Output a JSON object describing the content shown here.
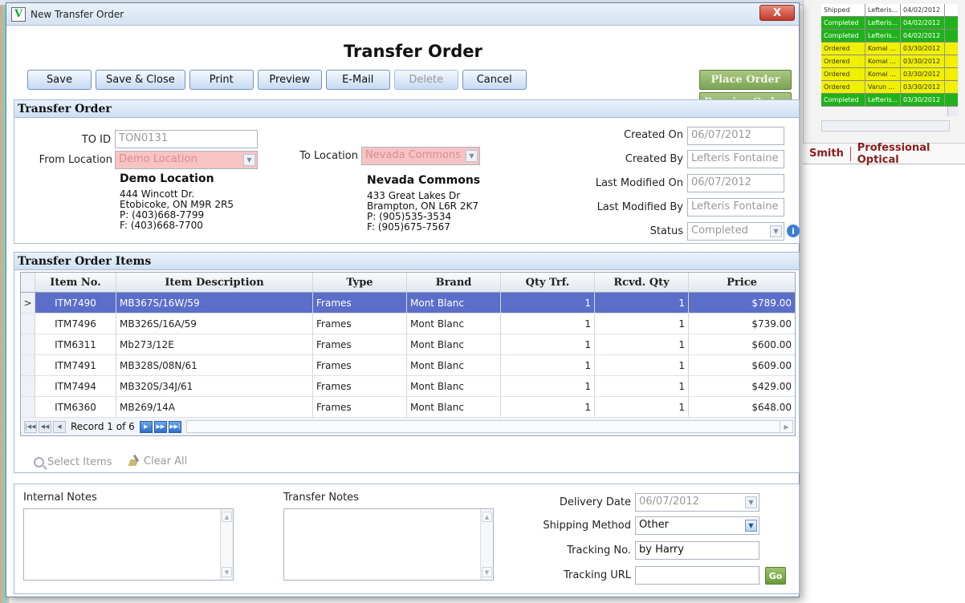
{
  "window": {
    "title": "New Transfer Order",
    "close_label": "X"
  },
  "form": {
    "title": "Transfer Order"
  },
  "toolbar": {
    "buttons": [
      {
        "label": "Save"
      },
      {
        "label": "Save & Close"
      },
      {
        "label": "Print"
      },
      {
        "label": "Preview"
      },
      {
        "label": "E-Mail"
      },
      {
        "label": "Delete"
      },
      {
        "label": "Cancel"
      }
    ],
    "place_order": "Place Order",
    "receive_order": "Receive Order"
  },
  "order": {
    "section_title": "Transfer Order",
    "to_id_label": "TO ID",
    "to_id": "TON0131",
    "from_location_label": "From Location",
    "from_location": "Demo Location",
    "to_location_label": "To Location",
    "to_location": "Nevada Commons",
    "from_address": {
      "name": "Demo Location",
      "line1": "444 Wincott Dr.",
      "line2": "Etobicoke, ON M9R 2R5",
      "phone": "P: (403)668-7799",
      "fax": "F: (403)668-7700"
    },
    "to_address": {
      "name": "Nevada Commons",
      "line1": "433 Great Lakes Dr",
      "line2": "Brampton, ON L6R 2K7",
      "phone": "P: (905)535-3534",
      "fax": "F: (905)675-7567"
    },
    "created_on_label": "Created On",
    "created_on": "06/07/2012",
    "created_by_label": "Created By",
    "created_by": "Lefteris Fontaine",
    "modified_on_label": "Last Modified On",
    "modified_on": "06/07/2012",
    "modified_by_label": "Last Modified By",
    "modified_by": "Lefteris Fontaine",
    "status_label": "Status",
    "status": "Completed"
  },
  "items": {
    "section_title": "Transfer Order Items",
    "columns": [
      "Item No.",
      "Item Description",
      "Type",
      "Brand",
      "Qty Trf.",
      "Rcvd. Qty",
      "Price"
    ],
    "rows": [
      {
        "no": "ITM7490",
        "desc": "MB367S/16W/59",
        "type": "Frames",
        "brand": "Mont Blanc",
        "qty": "1",
        "rcvd": "1",
        "price": "$789.00"
      },
      {
        "no": "ITM7496",
        "desc": "MB326S/16A/59",
        "type": "Frames",
        "brand": "Mont Blanc",
        "qty": "1",
        "rcvd": "1",
        "price": "$739.00"
      },
      {
        "no": "ITM6311",
        "desc": "Mb273/12E",
        "type": "Frames",
        "brand": "Mont Blanc",
        "qty": "1",
        "rcvd": "1",
        "price": "$600.00"
      },
      {
        "no": "ITM7491",
        "desc": "MB328S/08N/61",
        "type": "Frames",
        "brand": "Mont Blanc",
        "qty": "1",
        "rcvd": "1",
        "price": "$609.00"
      },
      {
        "no": "ITM7494",
        "desc": "MB320S/34J/61",
        "type": "Frames",
        "brand": "Mont Blanc",
        "qty": "1",
        "rcvd": "1",
        "price": "$429.00"
      },
      {
        "no": "ITM6360",
        "desc": "MB269/14A",
        "type": "Frames",
        "brand": "Mont Blanc",
        "qty": "1",
        "rcvd": "1",
        "price": "$648.00"
      }
    ],
    "record_text": "Record 1 of 6",
    "select_items": "Select Items",
    "clear_all": "Clear All"
  },
  "notes": {
    "internal_label": "Internal Notes",
    "transfer_label": "Transfer Notes",
    "delivery_date_label": "Delivery Date",
    "delivery_date": "06/07/2012",
    "shipping_method_label": "Shipping Method",
    "shipping_method": "Other",
    "tracking_no_label": "Tracking No.",
    "tracking_no": "by Harry",
    "tracking_url_label": "Tracking URL",
    "tracking_url": "",
    "go_label": "Go"
  },
  "background": {
    "rows": [
      {
        "status": "Shipped",
        "by": "Lefteris...",
        "date": "04/02/2012",
        "color": "white"
      },
      {
        "status": "Completed",
        "by": "Lefteris...",
        "date": "04/02/2012",
        "color": "green"
      },
      {
        "status": "Completed",
        "by": "Lefteris...",
        "date": "04/02/2012",
        "color": "green"
      },
      {
        "status": "Ordered",
        "by": "Komal ...",
        "date": "03/30/2012",
        "color": "yellow"
      },
      {
        "status": "Ordered",
        "by": "Komal ...",
        "date": "03/30/2012",
        "color": "yellow"
      },
      {
        "status": "Ordered",
        "by": "Komal ...",
        "date": "03/30/2012",
        "color": "yellow"
      },
      {
        "status": "Ordered",
        "by": "Varun ...",
        "date": "03/30/2012",
        "color": "yellow"
      },
      {
        "status": "Completed",
        "by": "Lefteris...",
        "date": "03/30/2012",
        "color": "green"
      }
    ],
    "footer_name": "Smith",
    "footer_company": "Professional Optical"
  }
}
